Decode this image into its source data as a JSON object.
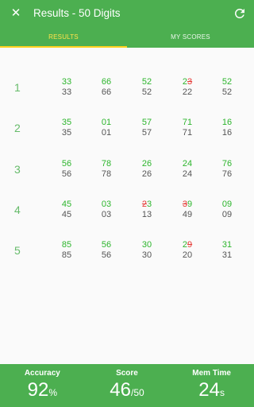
{
  "header": {
    "title": "Results - 50 Digits",
    "close_icon": "close-icon",
    "refresh_icon": "refresh-icon"
  },
  "tabs": [
    {
      "label": "RESULTS",
      "active": true
    },
    {
      "label": "MY SCORES",
      "active": false
    }
  ],
  "rows": [
    {
      "index": "1",
      "cells": [
        {
          "answer": [
            {
              "d": "3",
              "ok": true
            },
            {
              "d": "3",
              "ok": true
            }
          ],
          "key": "33"
        },
        {
          "answer": [
            {
              "d": "6",
              "ok": true
            },
            {
              "d": "6",
              "ok": true
            }
          ],
          "key": "66"
        },
        {
          "answer": [
            {
              "d": "5",
              "ok": true
            },
            {
              "d": "2",
              "ok": true
            }
          ],
          "key": "52"
        },
        {
          "answer": [
            {
              "d": "2",
              "ok": true
            },
            {
              "d": "3",
              "ok": false
            }
          ],
          "key": "22"
        },
        {
          "answer": [
            {
              "d": "5",
              "ok": true
            },
            {
              "d": "2",
              "ok": true
            }
          ],
          "key": "52"
        }
      ]
    },
    {
      "index": "2",
      "cells": [
        {
          "answer": [
            {
              "d": "3",
              "ok": true
            },
            {
              "d": "5",
              "ok": true
            }
          ],
          "key": "35"
        },
        {
          "answer": [
            {
              "d": "0",
              "ok": true
            },
            {
              "d": "1",
              "ok": true
            }
          ],
          "key": "01"
        },
        {
          "answer": [
            {
              "d": "5",
              "ok": true
            },
            {
              "d": "7",
              "ok": true
            }
          ],
          "key": "57"
        },
        {
          "answer": [
            {
              "d": "7",
              "ok": true
            },
            {
              "d": "1",
              "ok": true
            }
          ],
          "key": "71"
        },
        {
          "answer": [
            {
              "d": "1",
              "ok": true
            },
            {
              "d": "6",
              "ok": true
            }
          ],
          "key": "16"
        }
      ]
    },
    {
      "index": "3",
      "cells": [
        {
          "answer": [
            {
              "d": "5",
              "ok": true
            },
            {
              "d": "6",
              "ok": true
            }
          ],
          "key": "56"
        },
        {
          "answer": [
            {
              "d": "7",
              "ok": true
            },
            {
              "d": "8",
              "ok": true
            }
          ],
          "key": "78"
        },
        {
          "answer": [
            {
              "d": "2",
              "ok": true
            },
            {
              "d": "6",
              "ok": true
            }
          ],
          "key": "26"
        },
        {
          "answer": [
            {
              "d": "2",
              "ok": true
            },
            {
              "d": "4",
              "ok": true
            }
          ],
          "key": "24"
        },
        {
          "answer": [
            {
              "d": "7",
              "ok": true
            },
            {
              "d": "6",
              "ok": true
            }
          ],
          "key": "76"
        }
      ]
    },
    {
      "index": "4",
      "cells": [
        {
          "answer": [
            {
              "d": "4",
              "ok": true
            },
            {
              "d": "5",
              "ok": true
            }
          ],
          "key": "45"
        },
        {
          "answer": [
            {
              "d": "0",
              "ok": true
            },
            {
              "d": "3",
              "ok": true
            }
          ],
          "key": "03"
        },
        {
          "answer": [
            {
              "d": "2",
              "ok": false
            },
            {
              "d": "3",
              "ok": true
            }
          ],
          "key": "13"
        },
        {
          "answer": [
            {
              "d": "3",
              "ok": false
            },
            {
              "d": "9",
              "ok": true
            }
          ],
          "key": "49"
        },
        {
          "answer": [
            {
              "d": "0",
              "ok": true
            },
            {
              "d": "9",
              "ok": true
            }
          ],
          "key": "09"
        }
      ]
    },
    {
      "index": "5",
      "cells": [
        {
          "answer": [
            {
              "d": "8",
              "ok": true
            },
            {
              "d": "5",
              "ok": true
            }
          ],
          "key": "85"
        },
        {
          "answer": [
            {
              "d": "5",
              "ok": true
            },
            {
              "d": "6",
              "ok": true
            }
          ],
          "key": "56"
        },
        {
          "answer": [
            {
              "d": "3",
              "ok": true
            },
            {
              "d": "0",
              "ok": true
            }
          ],
          "key": "30"
        },
        {
          "answer": [
            {
              "d": "2",
              "ok": true
            },
            {
              "d": "9",
              "ok": false
            }
          ],
          "key": "20"
        },
        {
          "answer": [
            {
              "d": "3",
              "ok": true
            },
            {
              "d": "1",
              "ok": true
            }
          ],
          "key": "31"
        }
      ]
    }
  ],
  "footer": {
    "accuracy": {
      "label": "Accuracy",
      "value": "92",
      "unit": "%"
    },
    "score": {
      "label": "Score",
      "value": "46",
      "unit": "/50"
    },
    "mem_time": {
      "label": "Mem Time",
      "value": "24",
      "unit": "s"
    }
  },
  "colors": {
    "primary": "#4caf50",
    "correct": "#2db52d",
    "wrong": "#e53935",
    "tab_indicator": "#ffd21f",
    "key_text": "#555555"
  }
}
